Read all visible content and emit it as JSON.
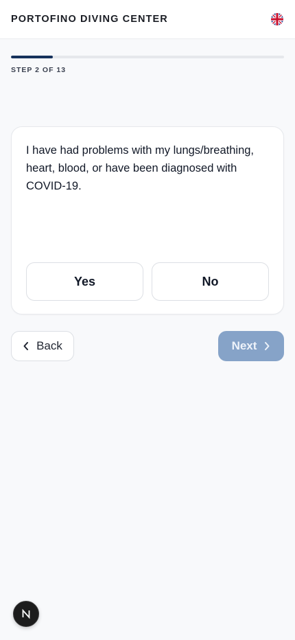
{
  "header": {
    "brand": "PORTOFINO DIVING CENTER",
    "language_icon": "uk-flag-icon"
  },
  "progress": {
    "current_step": 2,
    "total_steps": 13,
    "label": "STEP 2 OF 13",
    "fill_fraction": 0.154,
    "fill_color": "#16325c",
    "track_color": "#e6e8ec"
  },
  "question": {
    "text": "I have had problems with my lungs/breathing, heart, blood, or have been diagnosed with COVID-19.",
    "options": [
      "Yes",
      "No"
    ]
  },
  "navigation": {
    "back_label": "Back",
    "back_icon": "chevron-left-icon",
    "next_label": "Next",
    "next_icon": "chevron-right-icon",
    "next_disabled": true,
    "next_color": "#86a3c8"
  },
  "floating_button": {
    "icon": "n-logo-icon",
    "letter": "N"
  }
}
